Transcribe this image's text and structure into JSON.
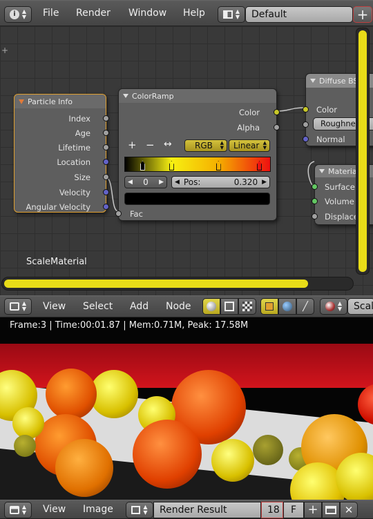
{
  "top_menu": {
    "file": "File",
    "render": "Render",
    "window": "Window",
    "help": "Help",
    "screen_layout": "Default",
    "info_icon": "info-icon",
    "layout_icon": "screen-layout-icon",
    "add_icon": "plus-icon"
  },
  "node_editor": {
    "material_name": "ScaleMaterial",
    "particle_info": {
      "title": "Particle Info",
      "outputs": [
        "Index",
        "Age",
        "Lifetime",
        "Location",
        "Size",
        "Velocity",
        "Angular Velocity"
      ]
    },
    "color_ramp": {
      "title": "ColorRamp",
      "out_color": "Color",
      "out_alpha": "Alpha",
      "add": "+",
      "remove": "−",
      "flip": "↔",
      "color_mode": "RGB",
      "interpolation": "Linear",
      "active_index": "0",
      "pos_label": "Pos:",
      "pos_value": "0.320",
      "input_fac": "Fac",
      "stops": [
        {
          "position": 0.0,
          "color": "#000000"
        },
        {
          "position": 0.32,
          "color": "#f7f012"
        },
        {
          "position": 0.64,
          "color": "#f5b000"
        },
        {
          "position": 1.0,
          "color": "#ee1010"
        }
      ]
    },
    "diffuse_bsdf": {
      "title": "Diffuse BS",
      "inputs": [
        "Color",
        "Roughnes",
        "Normal"
      ]
    },
    "material_output": {
      "title": "Materia",
      "inputs": [
        "Surface",
        "Volume",
        "Displace"
      ]
    }
  },
  "node_header": {
    "view": "View",
    "select": "Select",
    "add": "Add",
    "node": "Node",
    "scene_label": "Scal"
  },
  "render_view": {
    "stats": "Frame:3 | Time:00:01.87 | Mem:0.71M, Peak: 17.58M"
  },
  "image_header": {
    "view": "View",
    "image": "Image",
    "image_name": "Render Result",
    "slot": "18",
    "fake_user": "F"
  },
  "colors": {
    "accent_yellow": "#e8dc18",
    "node_bg": "#5e5e5e",
    "socket_purple": "#6363c7",
    "socket_grey": "#a0a0a0",
    "socket_yellow": "#c7c729",
    "socket_green": "#63c763"
  }
}
